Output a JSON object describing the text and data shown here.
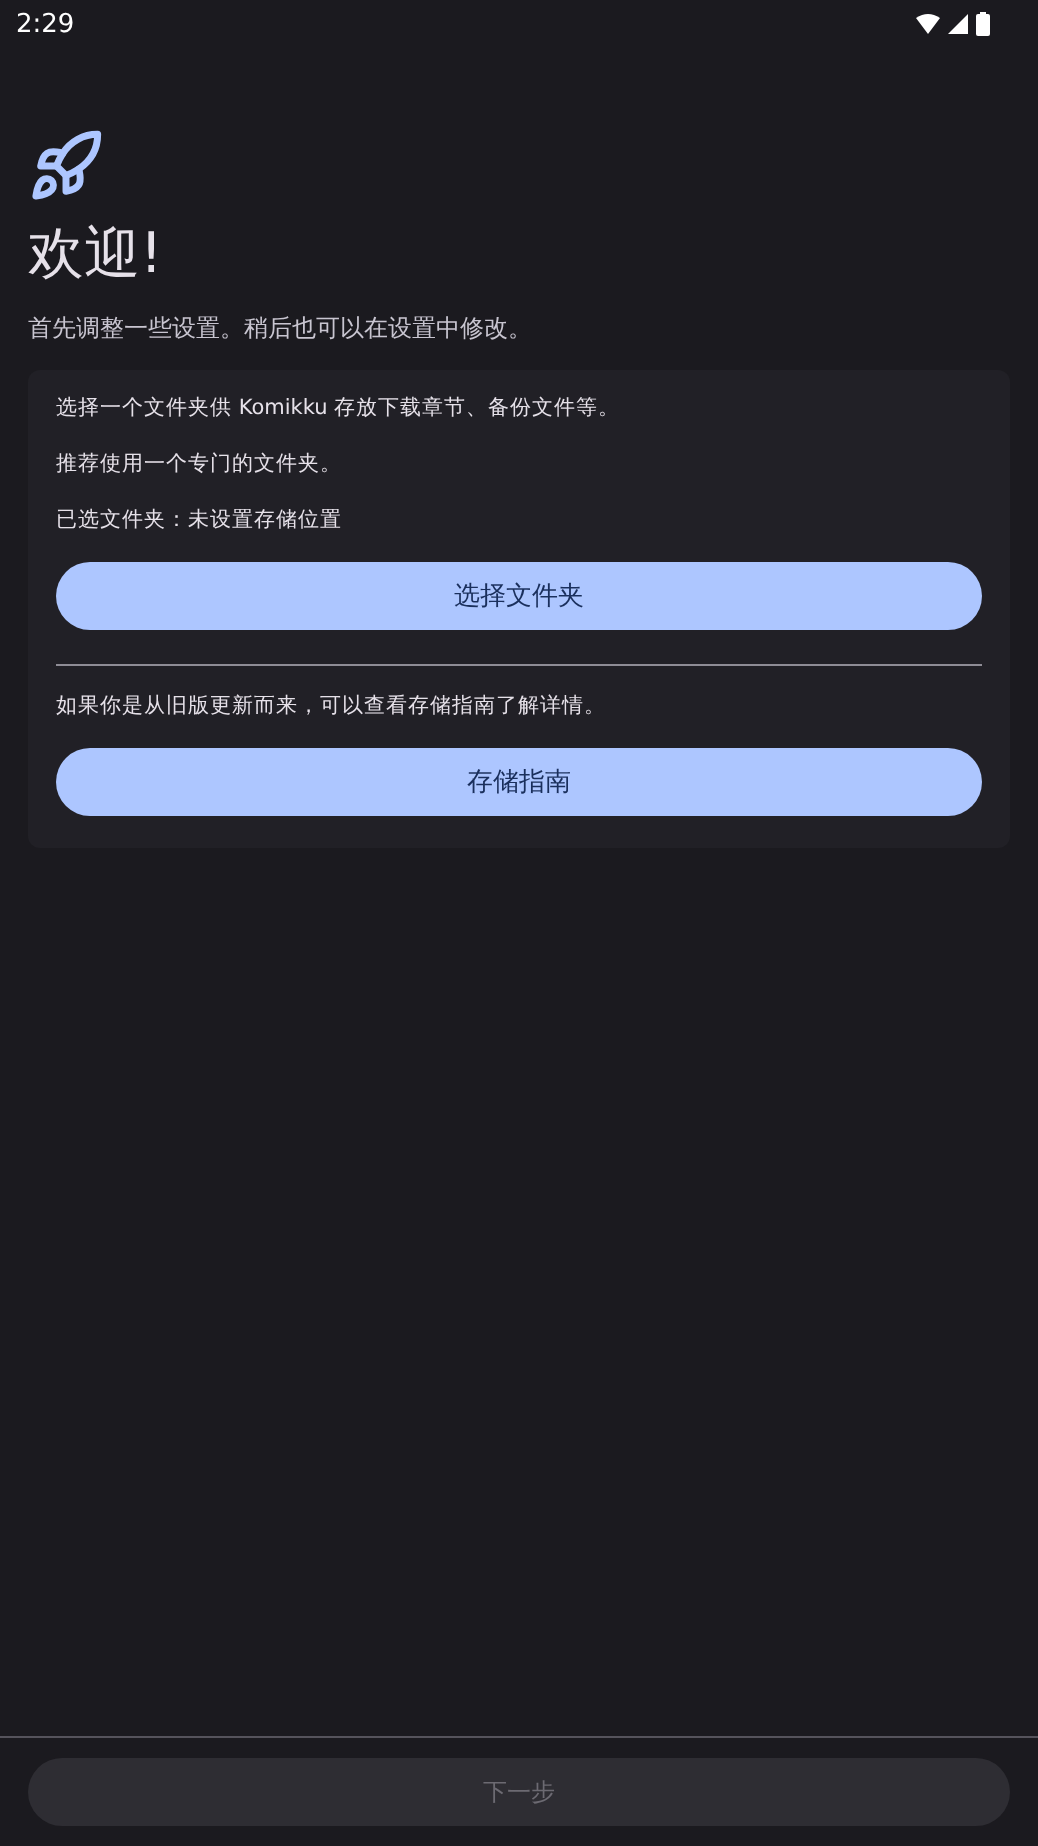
{
  "status_bar": {
    "time": "2:29"
  },
  "header": {
    "title": "欢迎!",
    "subtitle": "首先调整一些设置。稍后也可以在设置中修改。"
  },
  "storage_card": {
    "lines": [
      "选择一个文件夹供 Komikku 存放下载章节、备份文件等。",
      "推荐使用一个专门的文件夹。",
      "已选文件夹：未设置存储位置"
    ],
    "select_button": "选择文件夹",
    "migration_note": "如果你是从旧版更新而来，可以查看存储指南了解详情。",
    "guide_button": "存储指南"
  },
  "next_button": {
    "label": "下一步",
    "disabled": true
  }
}
